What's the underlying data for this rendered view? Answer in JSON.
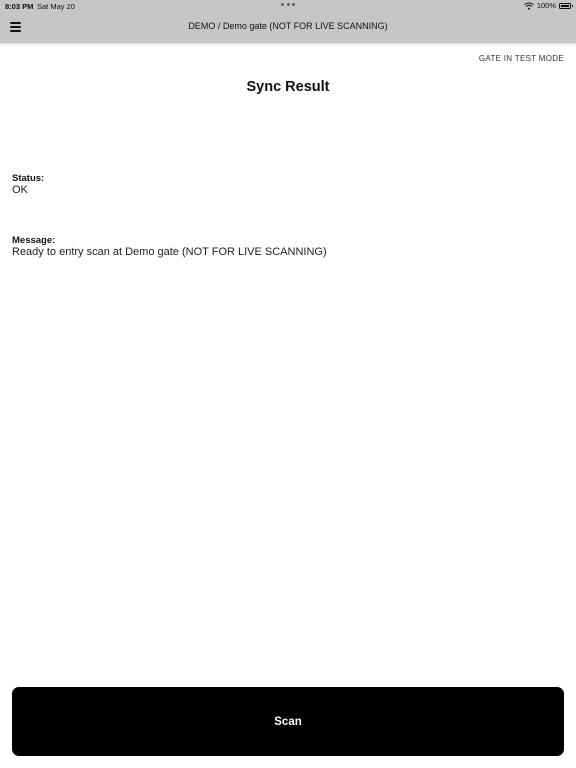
{
  "status_bar": {
    "time": "8:03 PM",
    "date": "Sat May 20",
    "battery": "100%",
    "icons": [
      "wifi-icon",
      "battery-icon"
    ]
  },
  "header": {
    "title": "DEMO / Demo gate (NOT FOR LIVE SCANNING)",
    "menu_icon": "hamburger-menu-icon"
  },
  "gate_mode": "GATE IN TEST MODE",
  "page_title": "Sync Result",
  "status": {
    "label": "Status:",
    "value": "OK"
  },
  "message": {
    "label": "Message:",
    "value": "Ready to entry scan at Demo gate (NOT FOR LIVE SCANNING)"
  },
  "scan_button": {
    "label": "Scan"
  },
  "colors": {
    "top_bar": "#c6c6c6",
    "button": "#000000",
    "button_text": "#ffffff"
  }
}
